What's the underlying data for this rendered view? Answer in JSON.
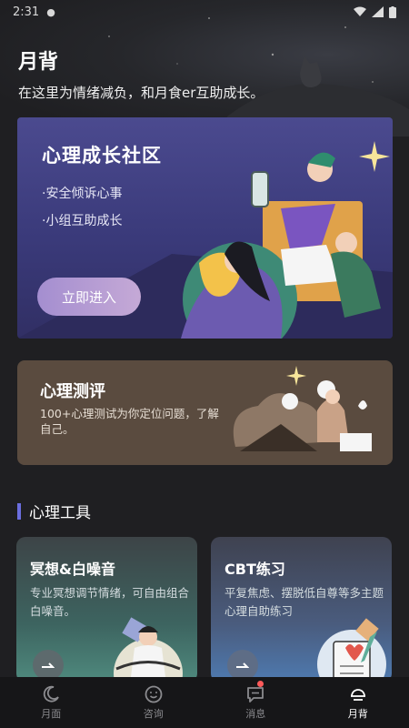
{
  "status_bar": {
    "time": "2:31"
  },
  "header": {
    "title": "月背",
    "subtitle": "在这里为情绪减负，和月食er互助成长。"
  },
  "community_card": {
    "title": "心理成长社区",
    "bullets": [
      "·安全倾诉心事",
      "·小组互助成长"
    ],
    "button_label": "立即进入"
  },
  "test_card": {
    "title": "心理测评",
    "description": "100+心理测试为你定位问题，了解自己。"
  },
  "tools_section": {
    "title": "心理工具",
    "cards": [
      {
        "title": "冥想&白噪音",
        "description": "专业冥想调节情绪，可自由组合白噪音。"
      },
      {
        "title": "CBT练习",
        "description": "平复焦虑、摆脱低自尊等多主题心理自助练习"
      }
    ]
  },
  "tab_bar": {
    "tabs": [
      {
        "label": "月面",
        "icon": "moon-icon"
      },
      {
        "label": "咨询",
        "icon": "smile-icon"
      },
      {
        "label": "消息",
        "icon": "message-icon"
      },
      {
        "label": "月背",
        "icon": "moon-back-icon"
      }
    ],
    "active_tab": "月背"
  },
  "colors": {
    "background": "#1f1f22",
    "accent": "#6b6ee0",
    "community_card": "#4b4a8f",
    "test_card": "#5a4b3f",
    "badge": "#ff5a5a"
  }
}
